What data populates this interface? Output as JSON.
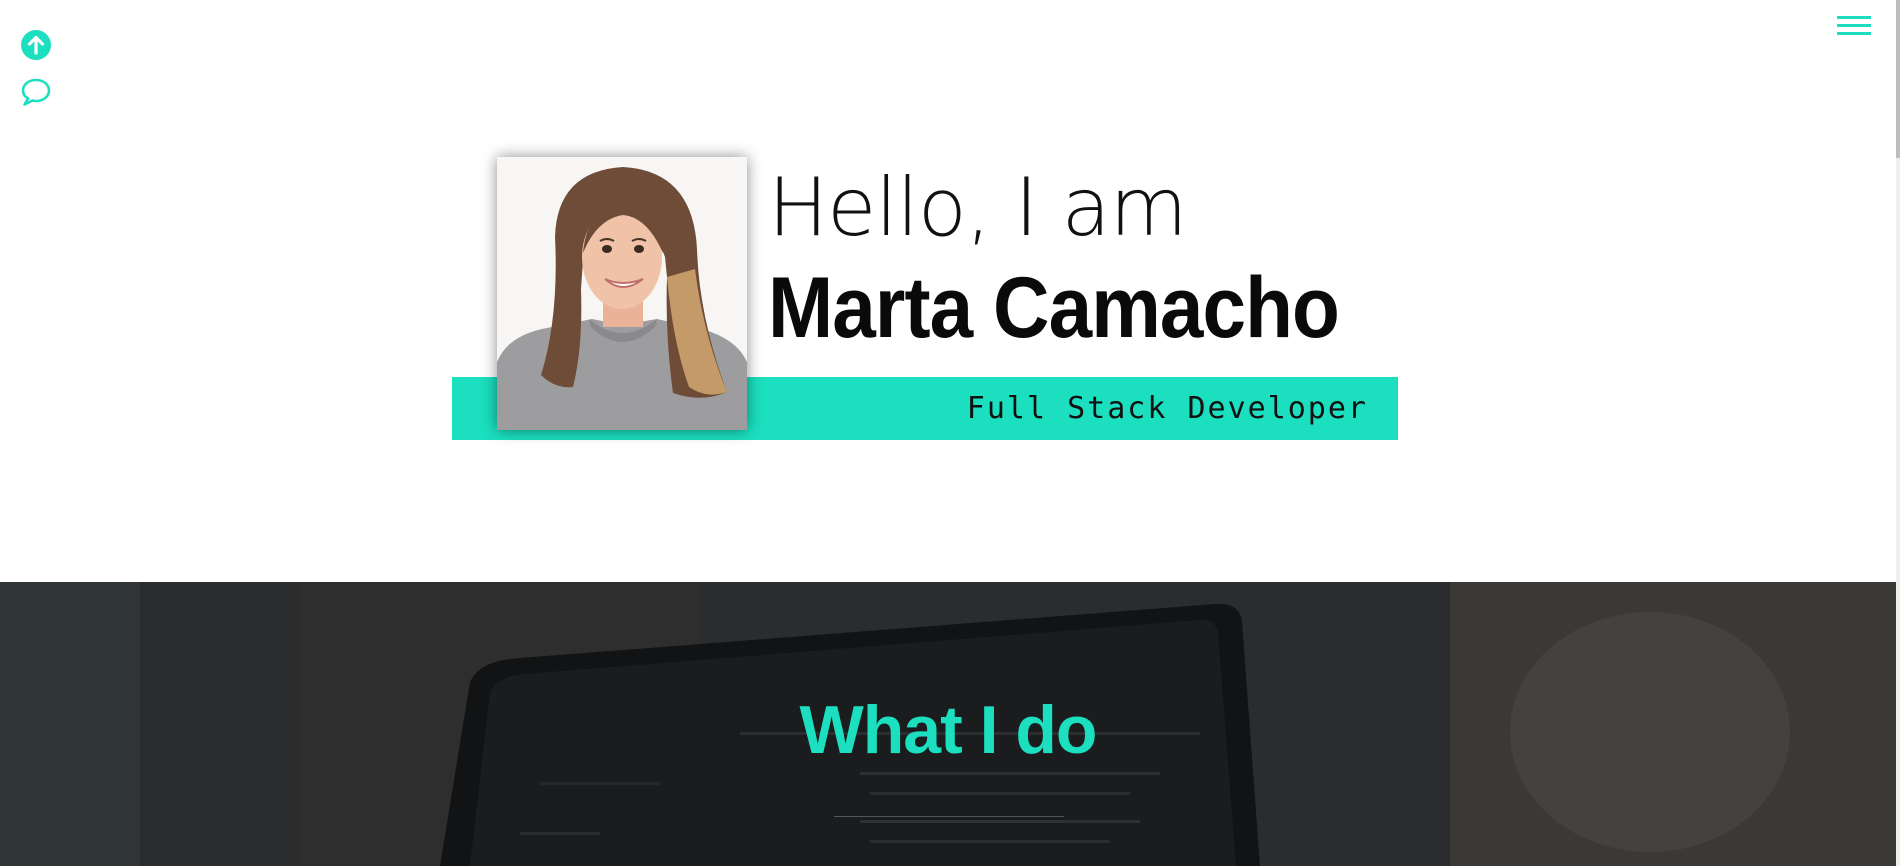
{
  "hero": {
    "greeting": "Hello, I am",
    "name": "Marta Camacho",
    "role": "Full Stack Developer",
    "photo_alt": "Marta Camacho"
  },
  "services": {
    "title": "What I do"
  },
  "icons": {
    "scroll_top": "arrow-up-circle-icon",
    "contact": "chat-bubble-icon",
    "menu": "hamburger-menu-icon"
  },
  "colors": {
    "accent": "#1bdfbf",
    "text": "#111111",
    "dark_section": "#242627"
  }
}
